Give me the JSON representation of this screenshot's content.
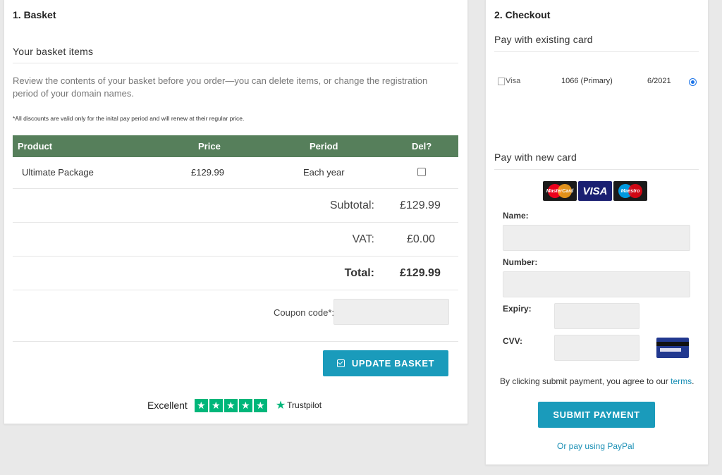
{
  "basket": {
    "title": "1. Basket",
    "items_heading": "Your basket items",
    "intro": "Review the contents of your basket before you order—you can delete items, or change the registration period of your domain names.",
    "discount_note": "*All discounts are valid only for the inital pay period and will renew at their regular price.",
    "table": {
      "headers": [
        "Product",
        "Price",
        "Period",
        "Del?"
      ],
      "rows": [
        {
          "product": "Ultimate Package",
          "price": "£129.99",
          "period": "Each year",
          "delete_checked": false
        }
      ]
    },
    "summary": {
      "subtotal_label": "Subtotal:",
      "subtotal_value": "£129.99",
      "vat_label": "VAT:",
      "vat_value": "£0.00",
      "total_label": "Total:",
      "total_value": "£129.99"
    },
    "coupon_label": "Coupon code*:",
    "coupon_value": "",
    "update_button": "UPDATE BASKET",
    "trustpilot": {
      "rating_text": "Excellent",
      "stars": 5,
      "brand": "Trustpilot",
      "brand_color": "#00b67a"
    }
  },
  "checkout": {
    "title": "2. Checkout",
    "existing_card_heading": "Pay with existing card",
    "existing_card": {
      "brand_alt": "Visa",
      "number": "1066 (Primary)",
      "expiry": "6/2021",
      "selected": true
    },
    "new_card_heading": "Pay with new card",
    "card_brands": [
      "MasterCard",
      "VISA",
      "Maestro"
    ],
    "fields": {
      "name_label": "Name:",
      "number_label": "Number:",
      "expiry_label": "Expiry:",
      "cvv_label": "CVV:"
    },
    "terms_text": "By clicking submit payment, you agree to our ",
    "terms_link": "terms",
    "terms_end": ".",
    "submit_button": "SUBMIT PAYMENT",
    "paypal_link": "Or pay using PayPal"
  },
  "colors": {
    "accent": "#1a9bbb",
    "table_header": "#567f5b",
    "page_bg": "#e9e9e9"
  }
}
